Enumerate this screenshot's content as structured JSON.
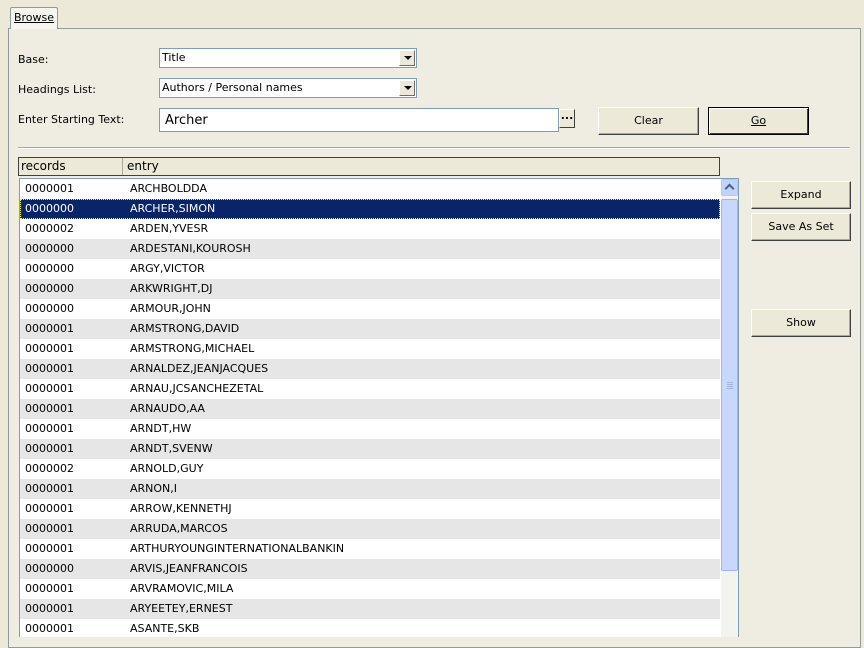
{
  "tabs": [
    {
      "label": "Browse"
    }
  ],
  "form": {
    "base_label": "Base:",
    "base_value": "Title",
    "headings_label": "Headings List:",
    "headings_value": "Authors / Personal names",
    "start_label": "Enter Starting Text:",
    "start_value": "Archer",
    "ellipsis_label": "..."
  },
  "buttons": {
    "clear": "Clear",
    "go": "Go",
    "expand": "Expand",
    "save_as_set": "Save As Set",
    "show": "Show"
  },
  "columns": {
    "records": "records",
    "entry": "entry"
  },
  "rows": [
    {
      "records": "0000001",
      "entry": "ARCHBOLDDA"
    },
    {
      "records": "0000000",
      "entry": "ARCHER,SIMON"
    },
    {
      "records": "0000002",
      "entry": "ARDEN,YVESR"
    },
    {
      "records": "0000000",
      "entry": "ARDESTANI,KOUROSH"
    },
    {
      "records": "0000000",
      "entry": "ARGY,VICTOR"
    },
    {
      "records": "0000000",
      "entry": "ARKWRIGHT,DJ"
    },
    {
      "records": "0000000",
      "entry": "ARMOUR,JOHN"
    },
    {
      "records": "0000001",
      "entry": "ARMSTRONG,DAVID"
    },
    {
      "records": "0000001",
      "entry": "ARMSTRONG,MICHAEL"
    },
    {
      "records": "0000001",
      "entry": "ARNALDEZ,JEANJACQUES"
    },
    {
      "records": "0000001",
      "entry": "ARNAU,JCSANCHEZETAL"
    },
    {
      "records": "0000001",
      "entry": "ARNAUDO,AA"
    },
    {
      "records": "0000001",
      "entry": "ARNDT,HW"
    },
    {
      "records": "0000001",
      "entry": "ARNDT,SVENW"
    },
    {
      "records": "0000002",
      "entry": "ARNOLD,GUY"
    },
    {
      "records": "0000001",
      "entry": "ARNON,I"
    },
    {
      "records": "0000001",
      "entry": "ARROW,KENNETHJ"
    },
    {
      "records": "0000001",
      "entry": "ARRUDA,MARCOS"
    },
    {
      "records": "0000001",
      "entry": "ARTHURYOUNGINTERNATIONALBANKIN"
    },
    {
      "records": "0000000",
      "entry": "ARVIS,JEANFRANCOIS"
    },
    {
      "records": "0000001",
      "entry": "ARVRAMOVIC,MILA"
    },
    {
      "records": "0000001",
      "entry": "ARYEETEY,ERNEST"
    },
    {
      "records": "0000001",
      "entry": "ASANTE,SKB"
    }
  ],
  "selected_row_index": 1,
  "colors": {
    "selection": "#0A246A",
    "alt_row": "#E6E6E6",
    "window_bg": "#ECE9D8"
  }
}
